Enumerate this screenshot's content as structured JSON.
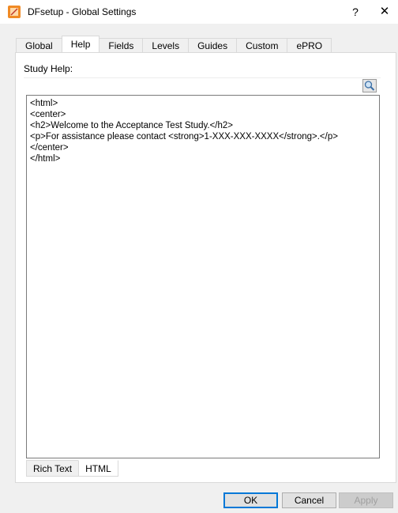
{
  "window": {
    "title": "DFsetup - Global Settings",
    "help_label": "?",
    "close_label": "✕"
  },
  "tabs": [
    {
      "label": "Global"
    },
    {
      "label": "Help"
    },
    {
      "label": "Fields"
    },
    {
      "label": "Levels"
    },
    {
      "label": "Guides"
    },
    {
      "label": "Custom"
    },
    {
      "label": "ePRO"
    }
  ],
  "active_tab": "Help",
  "help_panel": {
    "study_help_label": "Study Help:",
    "editor_lines": [
      "<html>",
      "<center>",
      "<h2>Welcome to the Acceptance Test Study.</h2>",
      "<p>For assistance please contact <strong>1-XXX-XXX-XXXX</strong>.</p>",
      "</center>",
      "</html>"
    ],
    "mode_tabs": [
      {
        "label": "Rich Text"
      },
      {
        "label": "HTML"
      }
    ],
    "active_mode": "HTML"
  },
  "buttons": {
    "ok": "OK",
    "cancel": "Cancel",
    "apply": "Apply"
  },
  "colors": {
    "accent": "#0078d7",
    "app_icon": "#f08a24"
  }
}
